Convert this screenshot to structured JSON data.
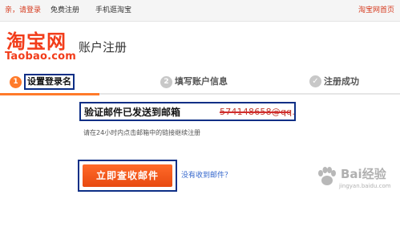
{
  "topbar": {
    "greeting": "亲，请登录",
    "register": "免费注册",
    "mobile": "手机逛淘宝",
    "home_link": "淘宝网首页"
  },
  "logo": {
    "cn": "淘宝网",
    "en": "Taobao.com"
  },
  "header": {
    "title": "账户注册"
  },
  "steps": [
    {
      "number": "1",
      "label": "设置登录名",
      "state": "active"
    },
    {
      "number": "2",
      "label": "填写账户信息",
      "state": "pending"
    },
    {
      "number": "✓",
      "label": "注册成功",
      "state": "pending"
    }
  ],
  "notice": {
    "text": "验证邮件已发送到邮箱",
    "email": "574148658@qq.com"
  },
  "hint": "请在24小时内点击邮箱中的链接继续注册",
  "actions": {
    "check_mail": "立即查收邮件",
    "no_mail": "没有收到邮件？"
  },
  "watermark": {
    "text": "Bai经验",
    "url": "jingyan.baidu.com"
  },
  "colors": {
    "accent": "#ff7a2a",
    "brand": "#f23c1a",
    "highlight_border": "#0d2f86",
    "link": "#3366cc"
  },
  "icons": {
    "step_done": "check-icon",
    "watermark": "paw-icon"
  }
}
